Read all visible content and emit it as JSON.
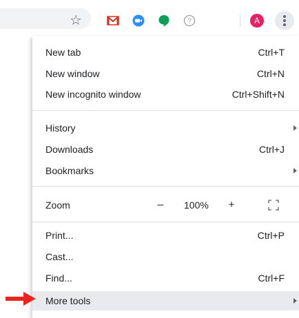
{
  "toolbar": {
    "bookmark_icon": "star-icon",
    "extensions": [
      "gmail-icon",
      "zoom-icon",
      "hangouts-icon",
      "help-icon"
    ],
    "profile_initial": "A",
    "profile_color": "#e91e63",
    "menu_icon": "kebab-menu-icon"
  },
  "menu": {
    "group1": [
      {
        "label": "New tab",
        "shortcut": "Ctrl+T"
      },
      {
        "label": "New window",
        "shortcut": "Ctrl+N"
      },
      {
        "label": "New incognito window",
        "shortcut": "Ctrl+Shift+N"
      }
    ],
    "group2": [
      {
        "label": "History",
        "has_submenu": true
      },
      {
        "label": "Downloads",
        "shortcut": "Ctrl+J"
      },
      {
        "label": "Bookmarks",
        "has_submenu": true
      }
    ],
    "zoom": {
      "label": "Zoom",
      "minus": "–",
      "value": "100%",
      "plus": "+",
      "fullscreen_icon": "fullscreen-icon"
    },
    "group3": [
      {
        "label": "Print...",
        "shortcut": "Ctrl+P"
      },
      {
        "label": "Cast..."
      },
      {
        "label": "Find...",
        "shortcut": "Ctrl+F"
      },
      {
        "label": "More tools",
        "has_submenu": true,
        "highlighted": true
      }
    ]
  },
  "annotation": {
    "arrow_color": "#e8251f"
  }
}
